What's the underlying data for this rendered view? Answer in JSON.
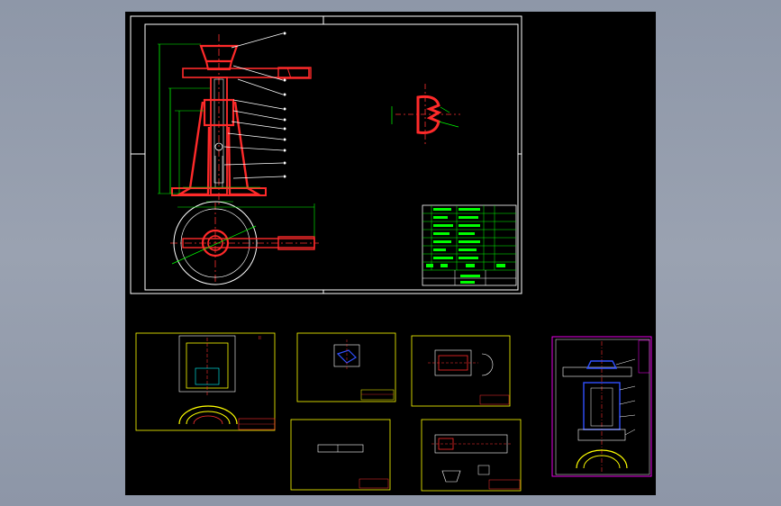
{
  "viewer": {
    "background_color": "#8b94a6",
    "drawing_background": "#000000"
  },
  "colors": {
    "frame": "#ffffff",
    "part_body": "#ff2a2a",
    "dimension": "#00ff00",
    "centerline": "#ff3030",
    "leader": "#ffffff",
    "sheet_border": "#ffff00",
    "sheet_border_active": "#ff00ff",
    "hatch_blue": "#3050ff",
    "cyan": "#00ffff",
    "magenta": "#ff00ff"
  },
  "main_sheet": {
    "title_block_rows": 8,
    "title_block_cols": 5
  },
  "sheets": [
    {
      "id": "sheet-1",
      "color": "#ffff00"
    },
    {
      "id": "sheet-2",
      "color": "#ffff00"
    },
    {
      "id": "sheet-3",
      "color": "#ffff00"
    },
    {
      "id": "sheet-4",
      "color": "#ffff00"
    },
    {
      "id": "sheet-5",
      "color": "#ffff00"
    },
    {
      "id": "sheet-6",
      "color": "#ffff00"
    },
    {
      "id": "sheet-7",
      "color": "#ff00ff"
    }
  ]
}
